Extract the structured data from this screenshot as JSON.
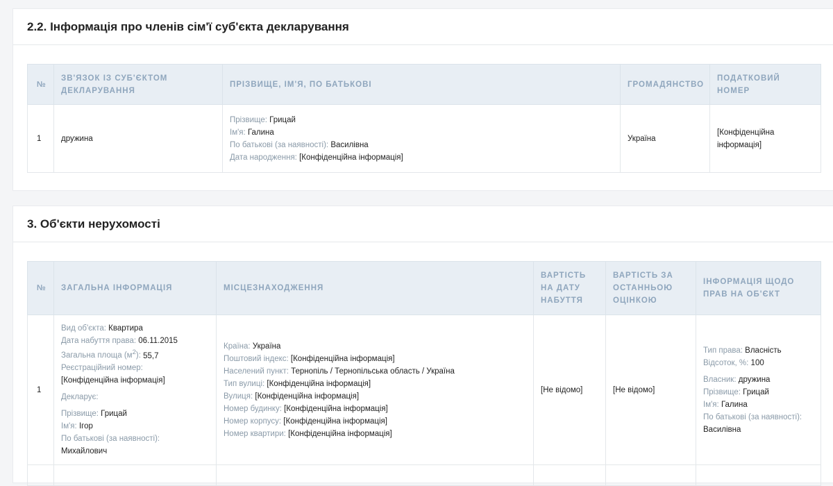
{
  "section22": {
    "title": "2.2. Інформація про членів сім'ї суб'єкта декларування",
    "headers": [
      "№",
      "ЗВ'ЯЗОК ІЗ СУБ'ЄКТОМ ДЕКЛАРУВАННЯ",
      "ПРІЗВИЩЕ, ІМ'Я, ПО БАТЬКОВІ",
      "ГРОМАДЯНСТВО",
      "ПОДАТКОВИЙ НОМЕР"
    ],
    "row": {
      "num": "1",
      "relation": "дружина",
      "surname_label": "Прізвище:",
      "surname": "Грицай",
      "name_label": "Ім'я:",
      "name": "Галина",
      "patronymic_label": "По батькові (за наявності):",
      "patronymic": "Василівна",
      "birth_label": "Дата народження:",
      "birth": "[Конфіденційна інформація]",
      "citizenship": "Україна",
      "tax_number": "[Конфіденційна інформація]"
    }
  },
  "section3": {
    "title": "3. Об'єкти нерухомості",
    "headers": [
      "№",
      "ЗАГАЛЬНА ІНФОРМАЦІЯ",
      "МІСЦЕЗНАХОДЖЕННЯ",
      "ВАРТІСТЬ НА ДАТУ НАБУТТЯ",
      "ВАРТІСТЬ ЗА ОСТАННЬОЮ ОЦІНКОЮ",
      "ІНФОРМАЦІЯ ЩОДО ПРАВ НА ОБ'ЄКТ"
    ],
    "row": {
      "num": "1",
      "general": {
        "type_label": "Вид об'єкта:",
        "type": "Квартира",
        "date_label": "Дата набуття права:",
        "date": "06.11.2015",
        "area_label": "Загальна площа (м",
        "area_sup": "2",
        "area_label_end": "):",
        "area": "55,7",
        "reg_label": "Реєстраційний номер:",
        "reg": "[Конфіденційна інформація]",
        "declarant_label": "Декларує:",
        "surname_label": "Прізвище:",
        "surname": "Грицай",
        "name_label": "Ім'я:",
        "name": "Ігор",
        "patronymic_label": "По батькові (за наявності):",
        "patronymic": "Михайлович"
      },
      "location": {
        "country_label": "Країна:",
        "country": "Україна",
        "zip_label": "Поштовий індекс:",
        "zip": "[Конфіденційна інформація]",
        "city_label": "Населений пункт:",
        "city": "Тернопіль / Тернопільська область / Україна",
        "street_type_label": "Тип вулиці:",
        "street_type": "[Конфіденційна інформація]",
        "street_label": "Вулиця:",
        "street": "[Конфіденційна інформація]",
        "house_label": "Номер будинку:",
        "house": "[Конфіденційна інформація]",
        "building_label": "Номер корпусу:",
        "building": "[Конфіденційна інформація]",
        "apt_label": "Номер квартири:",
        "apt": "[Конфіденційна інформація]"
      },
      "cost_acq": "[Не відомо]",
      "cost_last": "[Не відомо]",
      "rights": {
        "type_label": "Тип права:",
        "type": "Власність",
        "share_label": "Відсоток, %:",
        "share": "100",
        "owner_label": "Власник:",
        "owner": "дружина",
        "surname_label": "Прізвище:",
        "surname": "Грицай",
        "name_label": "Ім'я:",
        "name": "Галина",
        "patronymic_label": "По батькові (за наявності):",
        "patronymic": "Василівна"
      }
    }
  }
}
